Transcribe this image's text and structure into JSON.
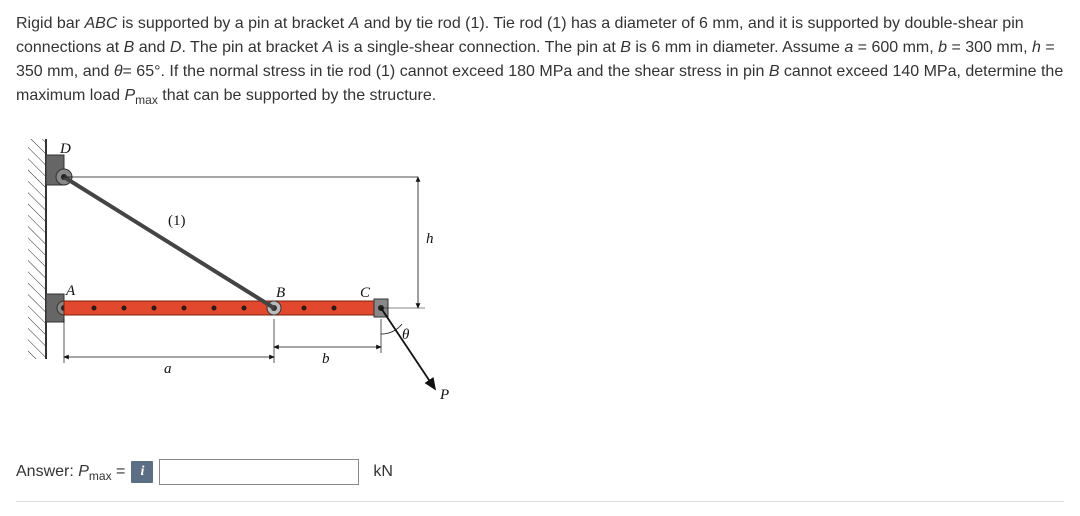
{
  "problem": {
    "p1a": "Rigid bar ",
    "abc": "ABC",
    "p1b": " is supported by a pin at bracket ",
    "A1": "A",
    "p1c": " and by tie rod (1). Tie rod (1) has a diameter of 6 mm, and it is supported by double-shear pin connections at ",
    "B1": "B",
    "p1d": " and ",
    "D1": "D",
    "p1e": ". The pin at bracket ",
    "A2": "A",
    "p1f": " is a single-shear connection. The pin at ",
    "B2": "B",
    "p1g": " is 6 mm in diameter. Assume ",
    "a": "a",
    "p1h": " = 600 mm, ",
    "b": "b",
    "p1i": " = 300 mm, ",
    "h": "h",
    "p1j": " = 350 mm, and ",
    "theta": "θ",
    "p1k": "= 65°. If the normal stress in tie rod (1) cannot exceed 180 MPa and the shear stress in pin ",
    "B3": "B",
    "p1l": " cannot exceed 140 MPa, determine the maximum load ",
    "P": "P",
    "max": "max",
    "p1m": " that can be supported by the structure."
  },
  "diagram": {
    "D": "D",
    "rod": "(1)",
    "A": "A",
    "B": "B",
    "C": "C",
    "a": "a",
    "b": "b",
    "h": "h",
    "theta": "θ",
    "P": "P"
  },
  "answer": {
    "label_pre": "Answer: ",
    "P": "P",
    "max": "max",
    "eq": " = ",
    "info": "i",
    "value": "",
    "unit": "kN"
  }
}
